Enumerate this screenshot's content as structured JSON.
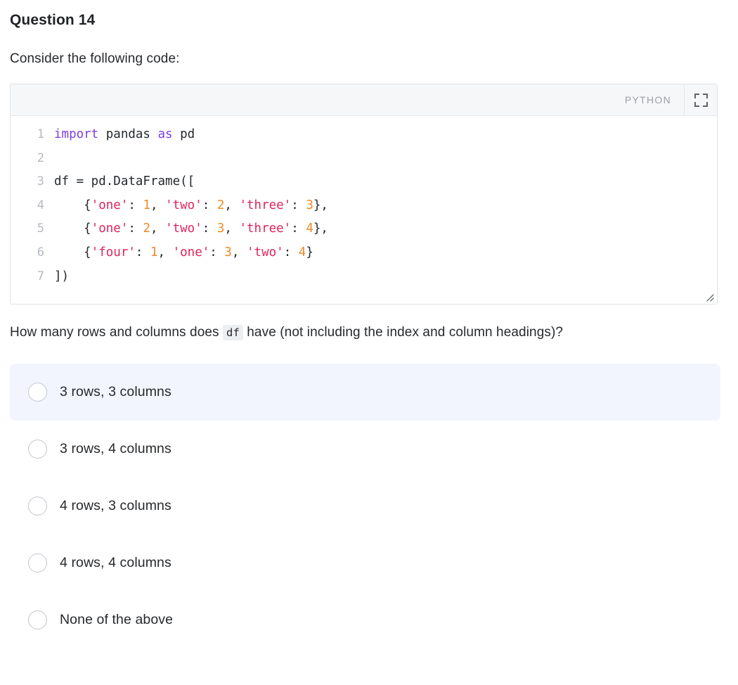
{
  "question": {
    "title": "Question 14",
    "intro": "Consider the following code:",
    "prompt_before": "How many rows and columns does ",
    "prompt_code": "df",
    "prompt_after": " have (not including the index and column headings)?"
  },
  "code_block": {
    "language_label": "PYTHON",
    "expand_icon": "expand-icon",
    "resize_handle": "resize-grip-icon",
    "lines": [
      {
        "number": "1",
        "text": "import pandas as pd"
      },
      {
        "number": "2",
        "text": ""
      },
      {
        "number": "3",
        "text": "df = pd.DataFrame(["
      },
      {
        "number": "4",
        "text": "    {'one': 1, 'two': 2, 'three': 3},"
      },
      {
        "number": "5",
        "text": "    {'one': 2, 'two': 3, 'three': 4},"
      },
      {
        "number": "6",
        "text": "    {'four': 1, 'one': 3, 'two': 4}"
      },
      {
        "number": "7",
        "text": "])"
      }
    ]
  },
  "options": [
    {
      "label": "3 rows, 3 columns",
      "highlighted": true,
      "selected": false
    },
    {
      "label": "3 rows, 4 columns",
      "highlighted": false,
      "selected": false
    },
    {
      "label": "4 rows, 3 columns",
      "highlighted": false,
      "selected": false
    },
    {
      "label": "4 rows, 4 columns",
      "highlighted": false,
      "selected": false
    },
    {
      "label": "None of the above",
      "highlighted": false,
      "selected": false
    }
  ],
  "colors": {
    "keyword": "#7b3fe4",
    "string": "#e0245e",
    "number": "#f08a24",
    "code_text": "#24292e",
    "line_number": "#b5b9be",
    "highlight_bg": "#f2f5fd",
    "header_bg": "#f6f7f8",
    "border": "#dfe2e5",
    "inline_code_bg": "#eceef0"
  }
}
